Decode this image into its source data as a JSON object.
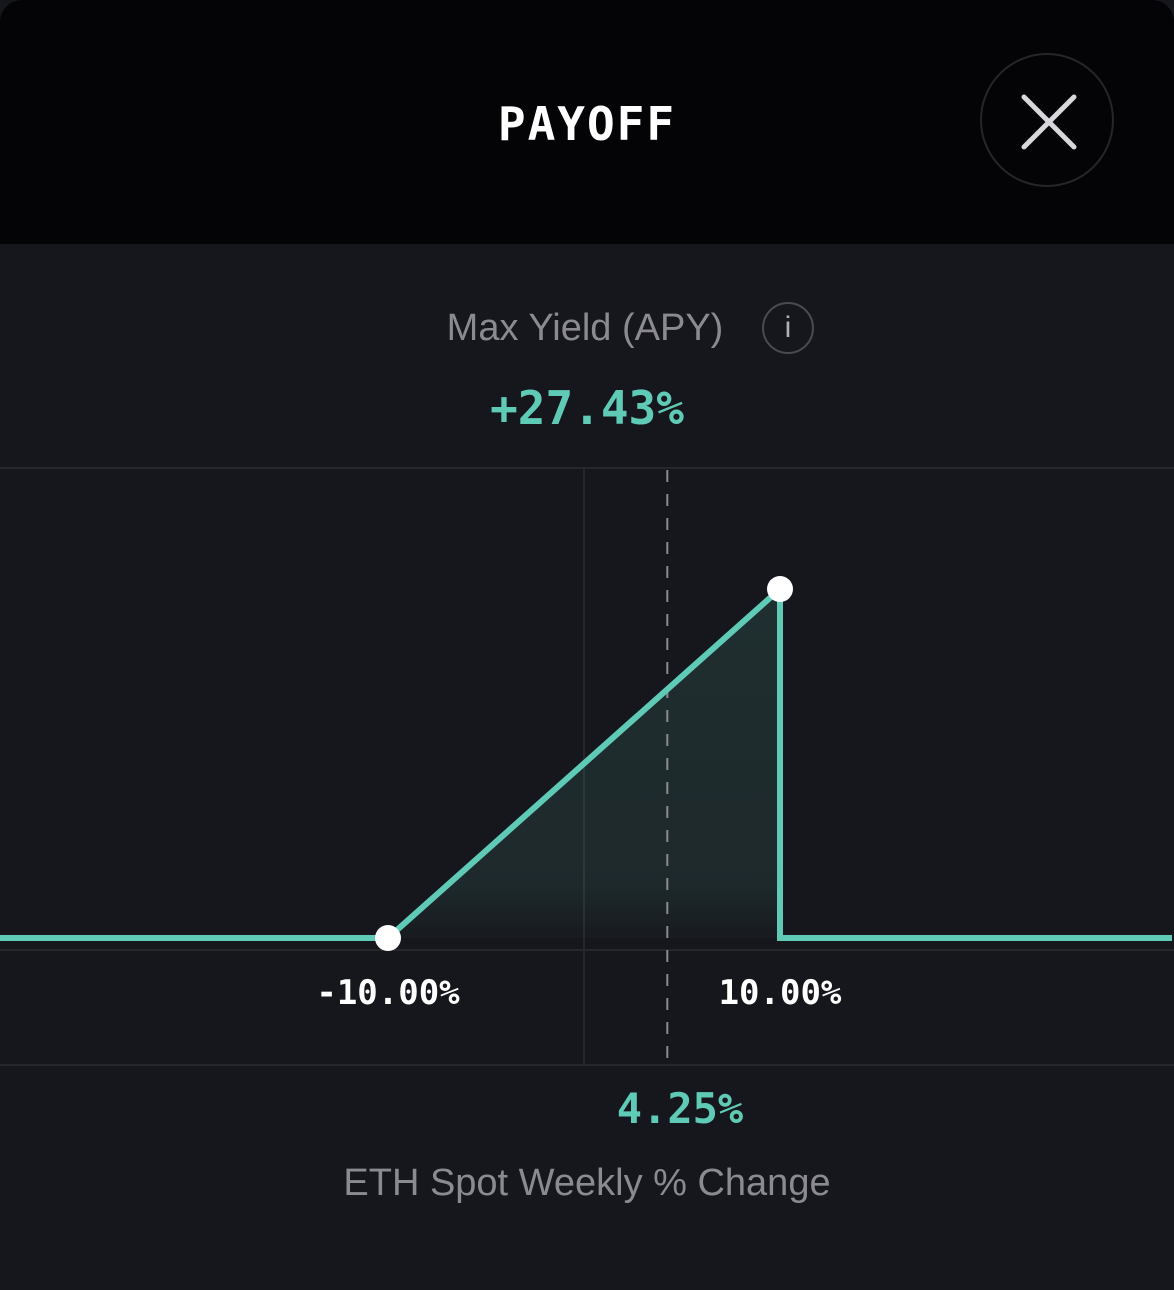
{
  "header": {
    "title": "PAYOFF",
    "close_icon": "close-icon"
  },
  "summary": {
    "yield_label": "Max Yield (APY)",
    "info_icon_glyph": "i",
    "yield_value": "+27.43%"
  },
  "colors": {
    "accent": "#5fcbb6",
    "header_bg": "#040406",
    "panel_bg": "#16171c",
    "muted_text": "#8a8a90"
  },
  "chart_data": {
    "type": "line",
    "xlabel": "ETH Spot Weekly % Change",
    "x_ticks": [
      {
        "value": -10,
        "label": "-10.00%"
      },
      {
        "value": 10,
        "label": "10.00%"
      }
    ],
    "current_spot": {
      "value": 4.25,
      "label": "4.25%"
    },
    "max_yield_apy": 27.43,
    "points": [
      {
        "x": -30,
        "y": 0
      },
      {
        "x": -10,
        "y": 0
      },
      {
        "x": 10,
        "y": 27.43
      },
      {
        "x": 10,
        "y": 0
      },
      {
        "x": 30,
        "y": 0
      }
    ],
    "markers": [
      {
        "x": -10,
        "y": 0
      },
      {
        "x": 10,
        "y": 27.43
      }
    ],
    "xlim": [
      -30,
      30
    ],
    "grid": true
  }
}
